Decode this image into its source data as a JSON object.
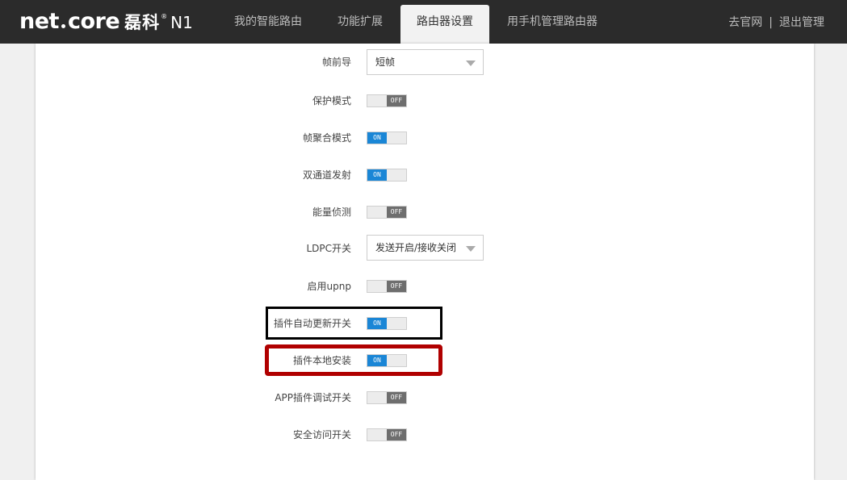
{
  "header": {
    "logo": {
      "brand": "net",
      "brand_suffix": "core",
      "cn": "磊科",
      "registered": "®",
      "model": "N1"
    },
    "nav": [
      {
        "label": "我的智能路由",
        "active": false
      },
      {
        "label": "功能扩展",
        "active": false
      },
      {
        "label": "路由器设置",
        "active": true
      },
      {
        "label": "用手机管理路由器",
        "active": false
      }
    ],
    "links": {
      "website": "去官网",
      "separator": "|",
      "logout": "退出管理"
    }
  },
  "settings": {
    "preamble": {
      "label": "帧前导",
      "value": "短帧"
    },
    "protection_mode": {
      "label": "保护模式",
      "state": "OFF"
    },
    "frame_aggregation": {
      "label": "帧聚合模式",
      "state": "ON"
    },
    "dual_channel_tx": {
      "label": "双通道发射",
      "state": "ON"
    },
    "energy_detect": {
      "label": "能量侦测",
      "state": "OFF"
    },
    "ldpc": {
      "label": "LDPC开关",
      "value": "发送开启/接收关闭"
    },
    "upnp": {
      "label": "启用upnp",
      "state": "OFF"
    },
    "plugin_auto_update": {
      "label": "插件自动更新开关",
      "state": "ON"
    },
    "plugin_local_install": {
      "label": "插件本地安装",
      "state": "ON"
    },
    "app_plugin_debug": {
      "label": "APP插件调试开关",
      "state": "OFF"
    },
    "secure_access": {
      "label": "安全访问开关",
      "state": "OFF"
    }
  },
  "colors": {
    "topbar": "#2b2b2b",
    "toggle_on": "#1a86d6",
    "toggle_off": "#6e6e6e",
    "highlight_black": "#000000",
    "highlight_red": "#b00000"
  }
}
